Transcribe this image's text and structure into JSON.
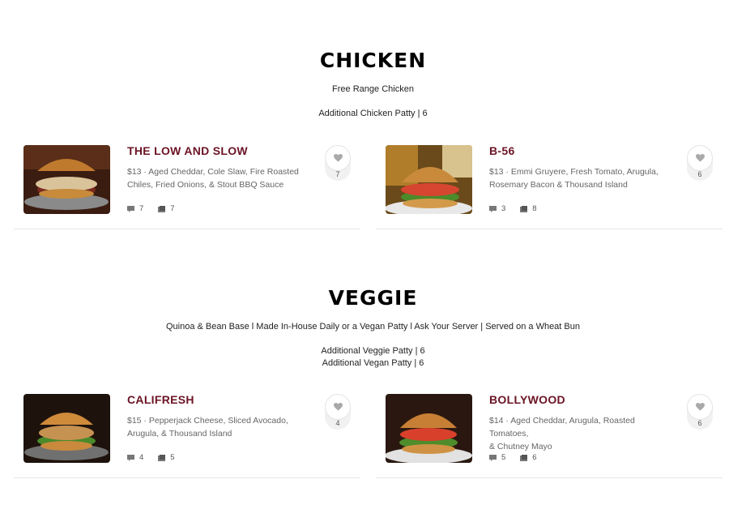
{
  "sections": [
    {
      "title": "CHICKEN",
      "lines": [
        "Free Range Chicken",
        "Additional Chicken Patty | 6"
      ],
      "items": [
        {
          "name": "THE LOW AND SLOW",
          "desc_line1": "$13 · Aged Cheddar, Cole Slaw, Fire Roasted",
          "desc_line2": "Chiles, Fried Onions, & Stout BBQ Sauce",
          "comments": "7",
          "photos": "7",
          "likes": "7"
        },
        {
          "name": "B-56",
          "desc_line1": "$13 · Emmi Gruyere, Fresh Tomato, Arugula,",
          "desc_line2": "Rosemary Bacon & Thousand Island",
          "comments": "3",
          "photos": "8",
          "likes": "6"
        }
      ]
    },
    {
      "title": "VEGGIE",
      "lines": [
        "Quinoa & Bean Base l Made In-House Daily or a Vegan Patty l Ask Your Server | Served on a Wheat Bun",
        "Additional Veggie Patty | 6",
        "Additional Vegan Patty | 6"
      ],
      "items": [
        {
          "name": "CALIFRESH",
          "desc_line1": "$15 · Pepperjack Cheese, Sliced Avocado,",
          "desc_line2": "Arugula, & Thousand Island",
          "comments": "4",
          "photos": "5",
          "likes": "4"
        },
        {
          "name": "BOLLYWOOD",
          "desc_line1": "$14 · Aged Cheddar, Arugula, Roasted Tomatoes,",
          "desc_line2": "& Chutney Mayo",
          "comments": "5",
          "photos": "6",
          "likes": "6"
        }
      ]
    }
  ],
  "icons": {
    "comment": "comment-icon",
    "photo": "photo-icon",
    "like": "heart-icon"
  },
  "colors": {
    "item_name": "#6b1424",
    "heart": "#a9a9a9"
  }
}
